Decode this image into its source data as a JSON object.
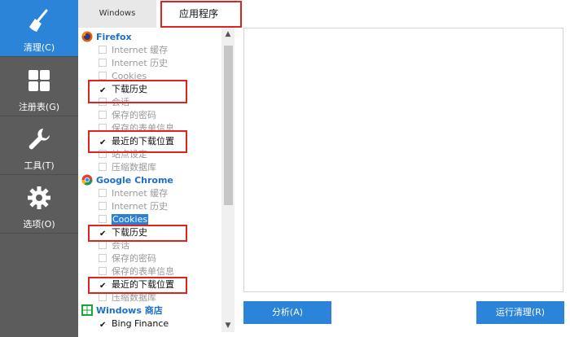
{
  "sidebar": {
    "items": [
      {
        "label": "清理(C)",
        "icon": "broom-icon",
        "active": true
      },
      {
        "label": "注册表(G)",
        "icon": "grid-icon",
        "active": false
      },
      {
        "label": "工具(T)",
        "icon": "wrench-icon",
        "active": false
      },
      {
        "label": "选项(O)",
        "icon": "gear-icon",
        "active": false
      }
    ]
  },
  "tabs": {
    "windows": "Windows",
    "apps": "应用程序"
  },
  "tree": {
    "firefox": {
      "name": "Firefox",
      "items": [
        {
          "label": "Internet 缓存",
          "checked": false
        },
        {
          "label": "Internet 历史",
          "checked": false
        },
        {
          "label": "Cookies",
          "checked": false
        },
        {
          "label": "下载历史",
          "checked": true
        },
        {
          "label": "会话",
          "checked": false
        },
        {
          "label": "保存的密码",
          "checked": false
        },
        {
          "label": "保存的表单信息",
          "checked": false
        },
        {
          "label": "最近的下载位置",
          "checked": true
        },
        {
          "label": "站点设定",
          "checked": false
        },
        {
          "label": "压缩数据库",
          "checked": false
        }
      ]
    },
    "chrome": {
      "name": "Google Chrome",
      "items": [
        {
          "label": "Internet 缓存",
          "checked": false
        },
        {
          "label": "Internet 历史",
          "checked": false
        },
        {
          "label": "Cookies",
          "checked": false
        },
        {
          "label": "下载历史",
          "checked": true
        },
        {
          "label": "会话",
          "checked": false
        },
        {
          "label": "保存的密码",
          "checked": false
        },
        {
          "label": "保存的表单信息",
          "checked": false
        },
        {
          "label": "最近的下载位置",
          "checked": true
        },
        {
          "label": "压缩数据库",
          "checked": false
        }
      ]
    },
    "store": {
      "name": "Windows 商店",
      "items": [
        {
          "label": "Bing Finance",
          "checked": true
        }
      ]
    }
  },
  "buttons": {
    "analyze": "分析(A)",
    "run": "运行清理(R)"
  },
  "colors": {
    "accent": "#2b84d7",
    "sidebar": "#5c5c5c",
    "highlight": "#e0231e"
  }
}
